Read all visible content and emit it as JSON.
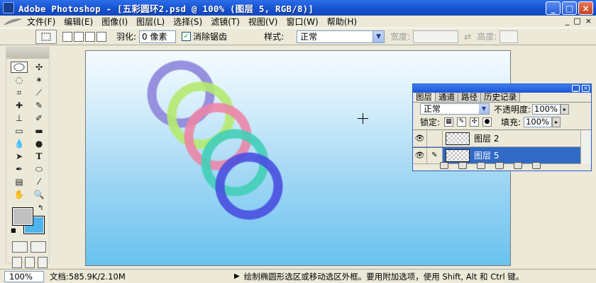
{
  "window": {
    "title": "Adobe Photoshop - [五彩圆环2.psd @ 100% (图层 5, RGB/8)]",
    "buttons": [
      "_",
      "□",
      "×"
    ]
  },
  "menu": {
    "items": [
      "文件(F)",
      "编辑(E)",
      "图像(I)",
      "图层(L)",
      "选择(S)",
      "滤镜(T)",
      "视图(V)",
      "窗口(W)",
      "帮助(H)"
    ],
    "doc_controls": [
      "_",
      "□",
      "×"
    ]
  },
  "options": {
    "feather_label": "羽化:",
    "feather_value": "0 像素",
    "antialias_label": "消除锯齿",
    "antialias_checked": true,
    "style_label": "样式:",
    "style_value": "正常",
    "width_label": "宽度:",
    "height_label": "高度:"
  },
  "tools": {
    "icons": [
      "rect-marquee-icon",
      "move-icon",
      "lasso-icon",
      "magic-wand-icon",
      "crop-icon",
      "slice-icon",
      "healing-brush-icon",
      "brush-icon",
      "clone-stamp-icon",
      "history-brush-icon",
      "eraser-icon",
      "gradient-icon",
      "blur-icon",
      "dodge-icon",
      "path-selection-icon",
      "type-icon",
      "pen-icon",
      "shape-icon",
      "notes-icon",
      "eyedropper-icon",
      "hand-icon",
      "zoom-icon"
    ],
    "foreground_color": "#c0c0c0",
    "background_color": "#4fb4ec"
  },
  "canvas": {
    "gradient_top": "#f5fbfe",
    "gradient_bottom": "#69c2ee",
    "rings": [
      {
        "color": "#8f86dc",
        "name": "purple-ring"
      },
      {
        "color": "#b5ea70",
        "name": "green-ring"
      },
      {
        "color": "#ec86a8",
        "name": "pink-ring"
      },
      {
        "color": "#43d0b8",
        "name": "teal-ring"
      },
      {
        "color": "#4a50e0",
        "name": "blue-ring"
      }
    ]
  },
  "layers_panel": {
    "tabs": [
      "图层",
      "通道",
      "路径",
      "历史记录"
    ],
    "blend_mode": "正常",
    "opacity_label": "不透明度:",
    "opacity_value": "100%",
    "lock_label": "锁定:",
    "fill_label": "填充:",
    "fill_value": "100%",
    "layers": [
      {
        "name": "图层 2",
        "selected": false
      },
      {
        "name": "图层 5",
        "selected": true
      }
    ]
  },
  "status": {
    "zoom": "100%",
    "doc_info": "文档:585.9K/2.10M",
    "hint": "绘制椭圆形选区或移动选区外框。要用附加选项，使用 Shift, Alt 和 Ctrl 键。"
  }
}
